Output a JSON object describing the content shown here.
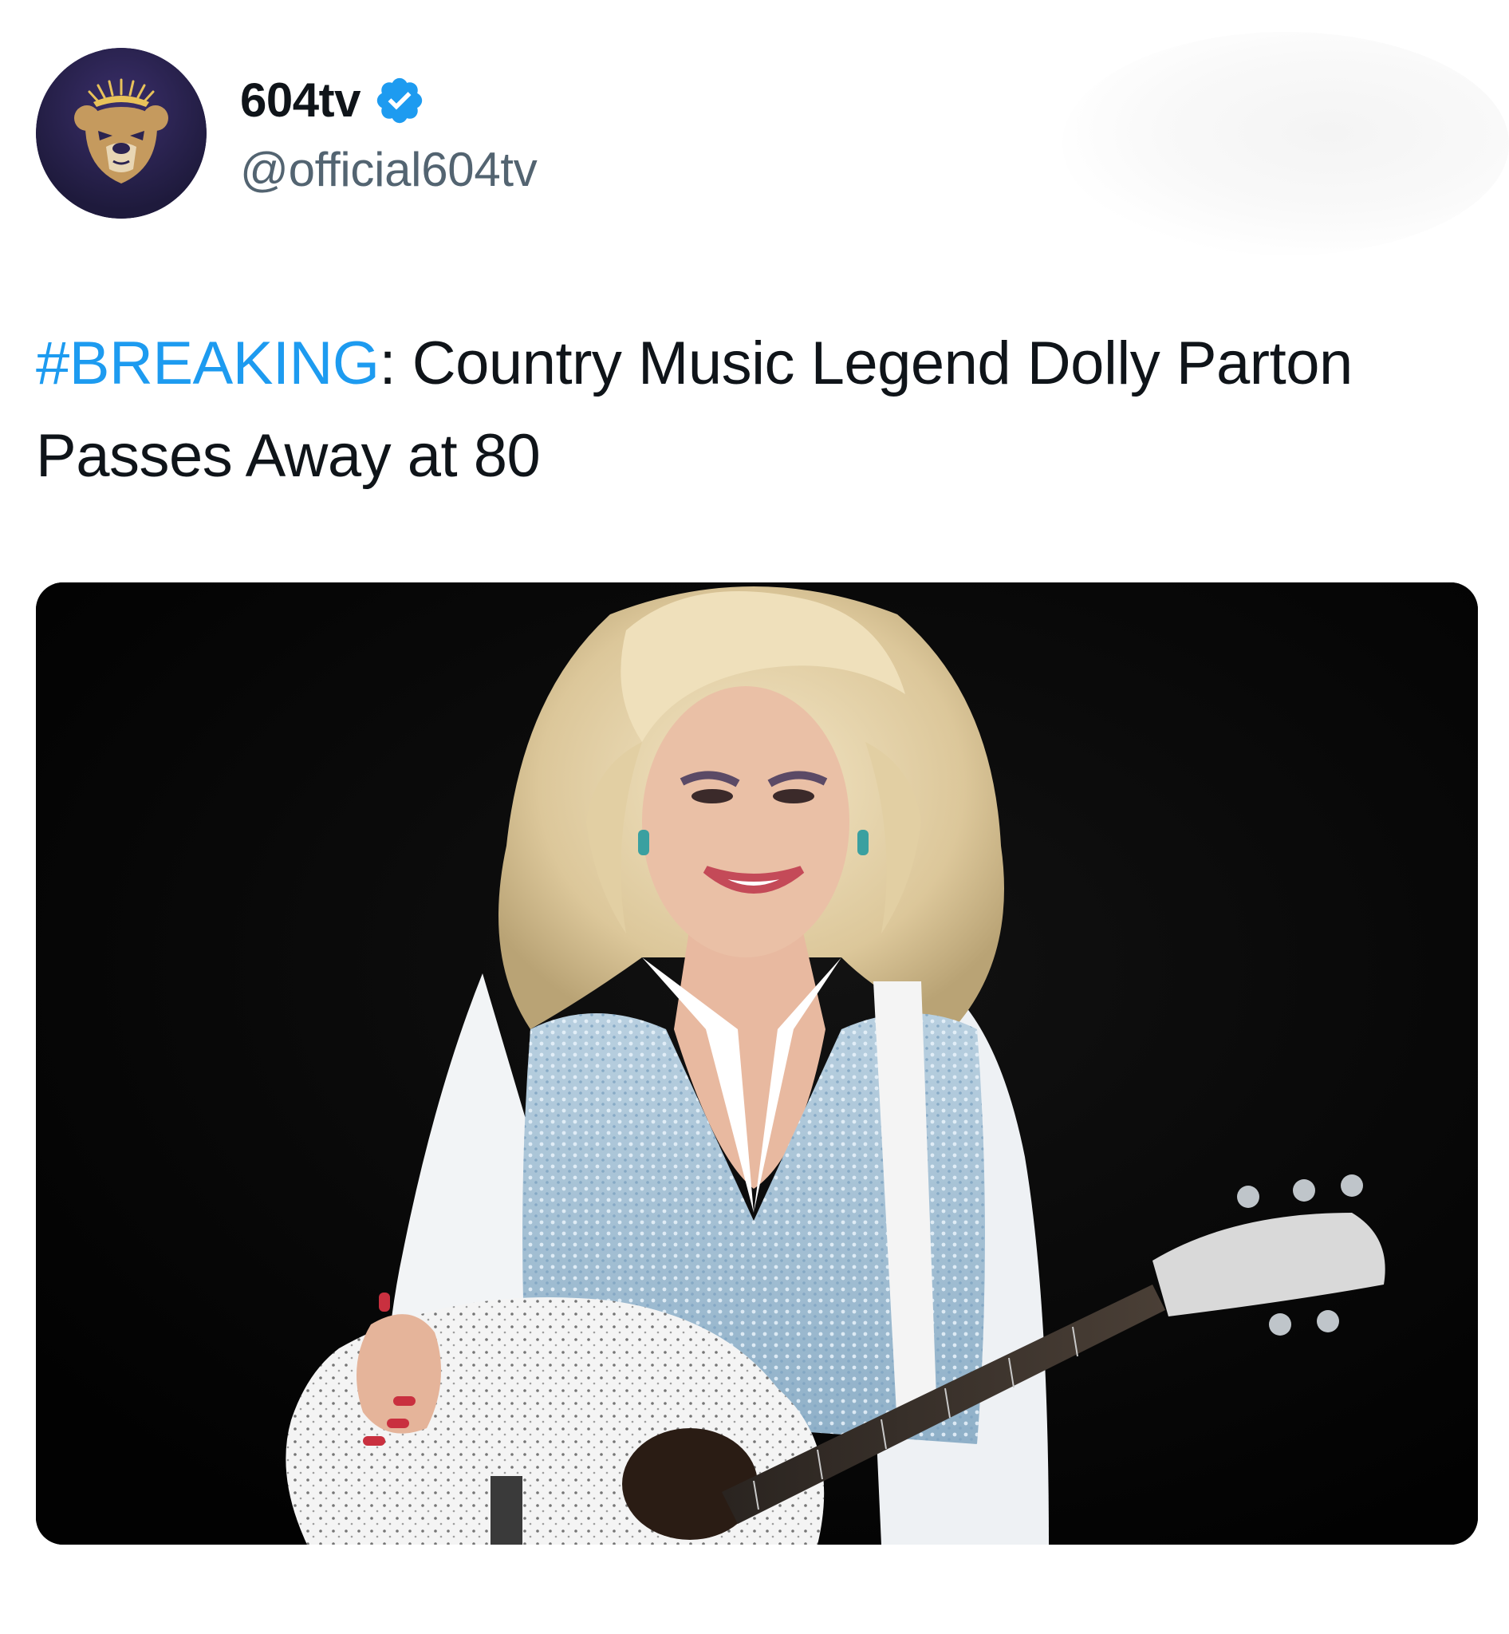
{
  "post": {
    "author": {
      "display_name": "604tv",
      "handle": "@official604tv",
      "verified": true,
      "avatar_icon": "bear-logo-icon",
      "avatar_colors": {
        "bg": "#2b2350",
        "bear": "#c59a5e",
        "crown": "#e8c25a"
      }
    },
    "text": {
      "hashtag": "#BREAKING",
      "body": ": Country Music Legend Dolly Parton Passes Away at 80"
    },
    "media": {
      "kind": "photo",
      "icon": "performer-photo"
    },
    "colors": {
      "hashtag": "#1d9bf0",
      "verified_badge": "#1d9bf0",
      "handle": "#536471",
      "text": "#0f1419"
    }
  }
}
